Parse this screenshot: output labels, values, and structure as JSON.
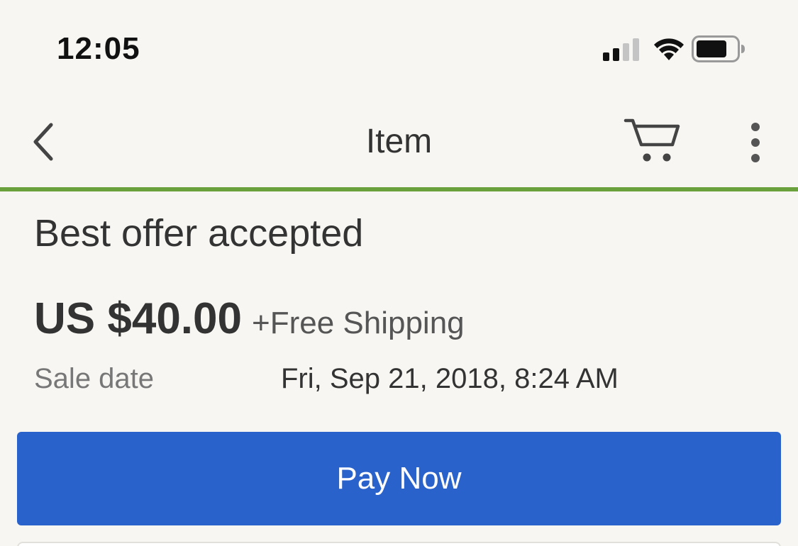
{
  "status_bar": {
    "time": "12:05",
    "icons": [
      "signal-icon",
      "wifi-icon",
      "battery-icon"
    ]
  },
  "nav": {
    "title": "Item",
    "back_icon": "chevron-left-icon",
    "cart_icon": "cart-icon",
    "more_icon": "more-vertical-icon",
    "accent_color": "#6aa13c"
  },
  "order": {
    "status": "Best offer accepted",
    "price": "US $40.00",
    "shipping": "+Free Shipping",
    "sale_date_label": "Sale date",
    "sale_date_value": "Fri, Sep 21, 2018, 8:24 AM"
  },
  "actions": {
    "pay_label": "Pay Now",
    "pay_color": "#2a62cc"
  }
}
